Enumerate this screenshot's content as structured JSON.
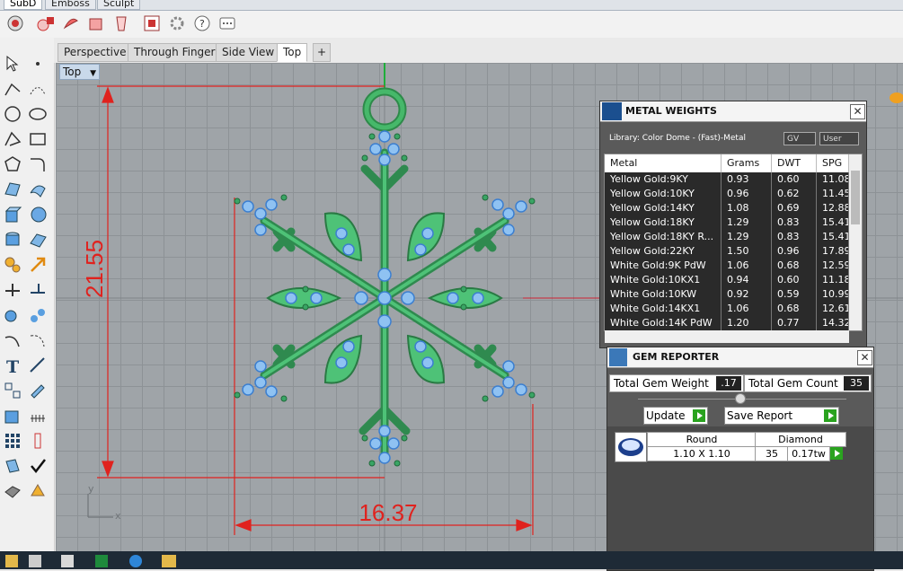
{
  "top_tabs": [
    "SubD",
    "Emboss",
    "Sculpt"
  ],
  "viewport_tabs": [
    "Perspective",
    "Through Finger",
    "Side View",
    "Top"
  ],
  "viewport_label": "Top",
  "dimensions": {
    "height": "21.55",
    "width": "16.37"
  },
  "axis": {
    "x": "x",
    "y": "y"
  },
  "metal_weights": {
    "title": "METAL WEIGHTS",
    "library": "Library: Color Dome - (Fast)-Metal",
    "gv_label": "GV",
    "user_label": "User",
    "columns": [
      "Metal",
      "Grams",
      "DWT",
      "SPG"
    ],
    "rows": [
      {
        "metal": "Yellow Gold:9KY",
        "grams": "0.93",
        "dwt": "0.60",
        "spg": "11.08"
      },
      {
        "metal": "Yellow Gold:10KY",
        "grams": "0.96",
        "dwt": "0.62",
        "spg": "11.45"
      },
      {
        "metal": "Yellow Gold:14KY",
        "grams": "1.08",
        "dwt": "0.69",
        "spg": "12.88"
      },
      {
        "metal": "Yellow Gold:18KY",
        "grams": "1.29",
        "dwt": "0.83",
        "spg": "15.41"
      },
      {
        "metal": "Yellow Gold:18KY R...",
        "grams": "1.29",
        "dwt": "0.83",
        "spg": "15.41"
      },
      {
        "metal": "Yellow Gold:22KY",
        "grams": "1.50",
        "dwt": "0.96",
        "spg": "17.89"
      },
      {
        "metal": "White Gold:9K PdW",
        "grams": "1.06",
        "dwt": "0.68",
        "spg": "12.59"
      },
      {
        "metal": "White Gold:10KX1",
        "grams": "0.94",
        "dwt": "0.60",
        "spg": "11.18"
      },
      {
        "metal": "White Gold:10KW",
        "grams": "0.92",
        "dwt": "0.59",
        "spg": "10.99"
      },
      {
        "metal": "White Gold:14KX1",
        "grams": "1.06",
        "dwt": "0.68",
        "spg": "12.61"
      },
      {
        "metal": "White Gold:14K PdW",
        "grams": "1.20",
        "dwt": "0.77",
        "spg": "14.32"
      }
    ]
  },
  "gem_reporter": {
    "title": "GEM REPORTER",
    "total_weight_label": "Total Gem Weight",
    "total_weight_value": ".17",
    "total_count_label": "Total Gem Count",
    "total_count_value": "35",
    "update_label": "Update",
    "save_label": "Save Report",
    "gem": {
      "shape": "Round",
      "size": "1.10 X 1.10",
      "type": "Diamond",
      "count": "35",
      "weight": "0.17tw"
    }
  },
  "colors": {
    "dimension": "#e0221e",
    "metal": "#3fae68",
    "gem": "#7ab4ec"
  }
}
